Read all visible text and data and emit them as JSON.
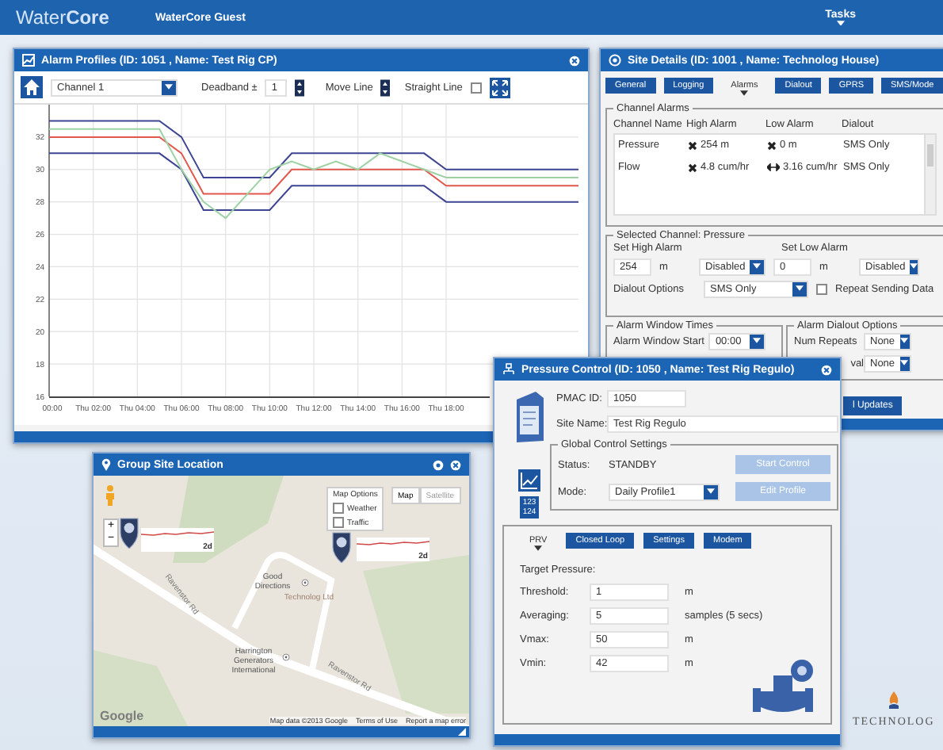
{
  "app_bar": {
    "logo": "Water**Core**",
    "user": "WaterCore Guest",
    "menu": "Tasks"
  },
  "alarm_profiles": {
    "title": "Alarm Profiles (ID: 1051 , Name: Test Rig CP)",
    "channel": "Channel 1",
    "deadband_label": "Deadband ±",
    "deadband": "1",
    "move_line_label": "Move Line",
    "straight_line_label": "Straight Line",
    "straight_line_checked": false,
    "chart_data": {
      "type": "line",
      "categories": [
        "00:00",
        null,
        "Thu 02:00",
        null,
        "Thu 04:00",
        null,
        "Thu 06:00",
        null,
        "Thu 08:00",
        null,
        "Thu 10:00",
        null,
        "Thu 12:00",
        null,
        "Thu 14:00",
        null,
        "Thu 16:00",
        null,
        "Thu 18:00",
        null,
        null,
        null,
        null,
        null,
        null
      ],
      "series": [
        {
          "color": "#3d4491",
          "values": [
            33,
            33,
            33,
            33,
            33,
            33,
            32,
            29.5,
            29.5,
            29.5,
            29.5,
            31,
            31,
            31,
            31,
            31,
            31,
            31,
            30,
            30,
            30,
            30,
            30,
            30,
            30
          ]
        },
        {
          "color": "#e2574c",
          "values": [
            32,
            32,
            32,
            32,
            32,
            32,
            31,
            28.5,
            28.5,
            28.5,
            28.5,
            30,
            30,
            30,
            30,
            30,
            30,
            30,
            29,
            29,
            29,
            29,
            29,
            29,
            29
          ]
        },
        {
          "color": "#3d4491",
          "values": [
            31,
            31,
            31,
            31,
            31,
            31,
            30,
            27.5,
            27.5,
            27.5,
            27.5,
            29,
            29,
            29,
            29,
            29,
            29,
            29,
            28,
            28,
            28,
            28,
            28,
            28,
            28
          ]
        },
        {
          "color": "#9ed1a3",
          "values": [
            32.5,
            32.5,
            32.5,
            32.5,
            32.5,
            32.5,
            30,
            28,
            27,
            28.5,
            30,
            30.5,
            30,
            30.5,
            30,
            31,
            30.5,
            30,
            29.5,
            29.5,
            29.5,
            29.5,
            29.5,
            29.5,
            29.5
          ]
        }
      ],
      "ylim": [
        16,
        34
      ],
      "grid": true,
      "yticks": [
        16,
        18,
        20,
        22,
        24,
        26,
        28,
        30,
        32
      ]
    }
  },
  "site_details": {
    "title": "Site Details (ID: 1001 , Name: Technolog House)",
    "tabs": [
      {
        "label": "General",
        "selected": false
      },
      {
        "label": "Logging",
        "selected": false
      },
      {
        "label": "Alarms",
        "selected": true
      },
      {
        "label": "Dialout",
        "selected": false
      },
      {
        "label": "GPRS",
        "selected": false
      },
      {
        "label": "SMS/Mode",
        "selected": false
      }
    ],
    "channel_alarms": {
      "legend": "Channel Alarms",
      "columns": [
        "Channel Name",
        "High Alarm",
        "Low Alarm",
        "Dialout"
      ],
      "rows": [
        {
          "channel": "Pressure",
          "high": {
            "kind": "cross",
            "text": "254 m"
          },
          "low": {
            "kind": "cross",
            "text": "0 m"
          },
          "dialout": "SMS Only"
        },
        {
          "channel": "Flow",
          "high": {
            "kind": "cross",
            "text": "4.8 cum/hr"
          },
          "low": {
            "kind": "range",
            "text": "3.16 cum/hr"
          },
          "dialout": "SMS Only"
        }
      ]
    },
    "selected_channel": {
      "legend": "Selected Channel: Pressure",
      "high_label": "Set High Alarm",
      "high_value": "254",
      "high_unit": "m",
      "high_mode": "Disabled",
      "low_label": "Set Low Alarm",
      "low_value": "0",
      "low_unit": "m",
      "low_mode": "Disabled",
      "dialout_label": "Dialout Options",
      "dialout": "SMS Only",
      "repeat_label": "Repeat Sending Data",
      "repeat_checked": false
    },
    "alarm_window": {
      "legend": "Alarm Window Times",
      "start_label": "Alarm Window Start",
      "start": "00:00"
    },
    "dialout_options": {
      "legend": "Alarm Dialout Options",
      "repeats_label": "Num Repeats",
      "repeats": "None",
      "interval_label": "val",
      "interval": "None"
    },
    "update_button": "l Updates"
  },
  "site_location": {
    "title": "Group Site Location",
    "zoom_in": "+",
    "zoom_out": "−",
    "map_options": "Map Options",
    "layers": [
      {
        "label": "Weather",
        "checked": false
      },
      {
        "label": "Traffic",
        "checked": false
      }
    ],
    "map_types": [
      {
        "label": "Map",
        "selected": true
      },
      {
        "label": "Satellite",
        "selected": false
      }
    ],
    "markers": [
      {
        "label": "2d"
      },
      {
        "label": "2d"
      }
    ],
    "places": [
      {
        "kind": "poi",
        "label": "Good Directions"
      },
      {
        "kind": "area",
        "label": "Technolog Ltd"
      },
      {
        "kind": "poi",
        "label": "Harrington Generators International"
      }
    ],
    "roads": [
      "Ravenstor Rd",
      "Ravenstor Rd"
    ],
    "logo": "Google",
    "footer": [
      "Map data ©2013 Google",
      "Terms of Use",
      "Report a map error"
    ]
  },
  "pressure_control": {
    "title": "Pressure Control (ID: 1050 , Name: Test Rig Regulo)",
    "counter": [
      "123",
      "124"
    ],
    "pmac_label": "PMAC ID:",
    "pmac": "1050",
    "site_label": "Site Name:",
    "site": "Test Rig Regulo",
    "global": {
      "legend": "Global Control Settings",
      "status_label": "Status:",
      "status": "STANDBY",
      "mode_label": "Mode:",
      "mode": "Daily Profile1",
      "buttons": [
        {
          "label": "Start Control",
          "disabled": true
        },
        {
          "label": "Edit Profile",
          "disabled": true
        }
      ]
    },
    "tabs": [
      {
        "label": "PRV",
        "selected": true
      },
      {
        "label": "Closed Loop",
        "selected": false
      },
      {
        "label": "Settings",
        "selected": false
      },
      {
        "label": "Modem",
        "selected": false
      }
    ],
    "target_label": "Target Pressure:",
    "fields": [
      {
        "label": "Threshold:",
        "value": "1",
        "unit": "m"
      },
      {
        "label": "Averaging:",
        "value": "5",
        "unit": "samples (5 secs)"
      },
      {
        "label": "Vmax:",
        "value": "50",
        "unit": "m"
      },
      {
        "label": "Vmin:",
        "value": "42",
        "unit": "m"
      }
    ]
  },
  "brand": {
    "name": "TECHNOLOG"
  }
}
